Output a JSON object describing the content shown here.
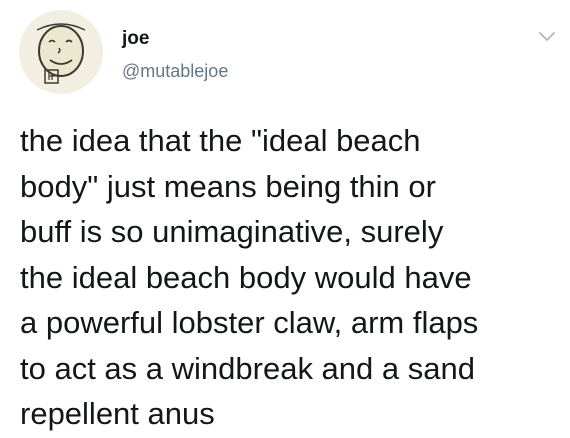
{
  "author": {
    "display_name": "joe",
    "handle": "@mutablejoe",
    "avatar_icon": "hand-drawn-face-avatar"
  },
  "header": {
    "menu_icon": "chevron-down-icon"
  },
  "tweet": {
    "text": "the idea that the \"ideal beach\nbody\" just means being thin or\nbuff is so unimaginative, surely\nthe ideal beach body would have\na powerful lobster claw, arm flaps\nto act as a windbreak and a sand\nrepellent anus"
  },
  "colors": {
    "text_primary": "#14171a",
    "text_secondary": "#657786",
    "background": "#ffffff"
  }
}
